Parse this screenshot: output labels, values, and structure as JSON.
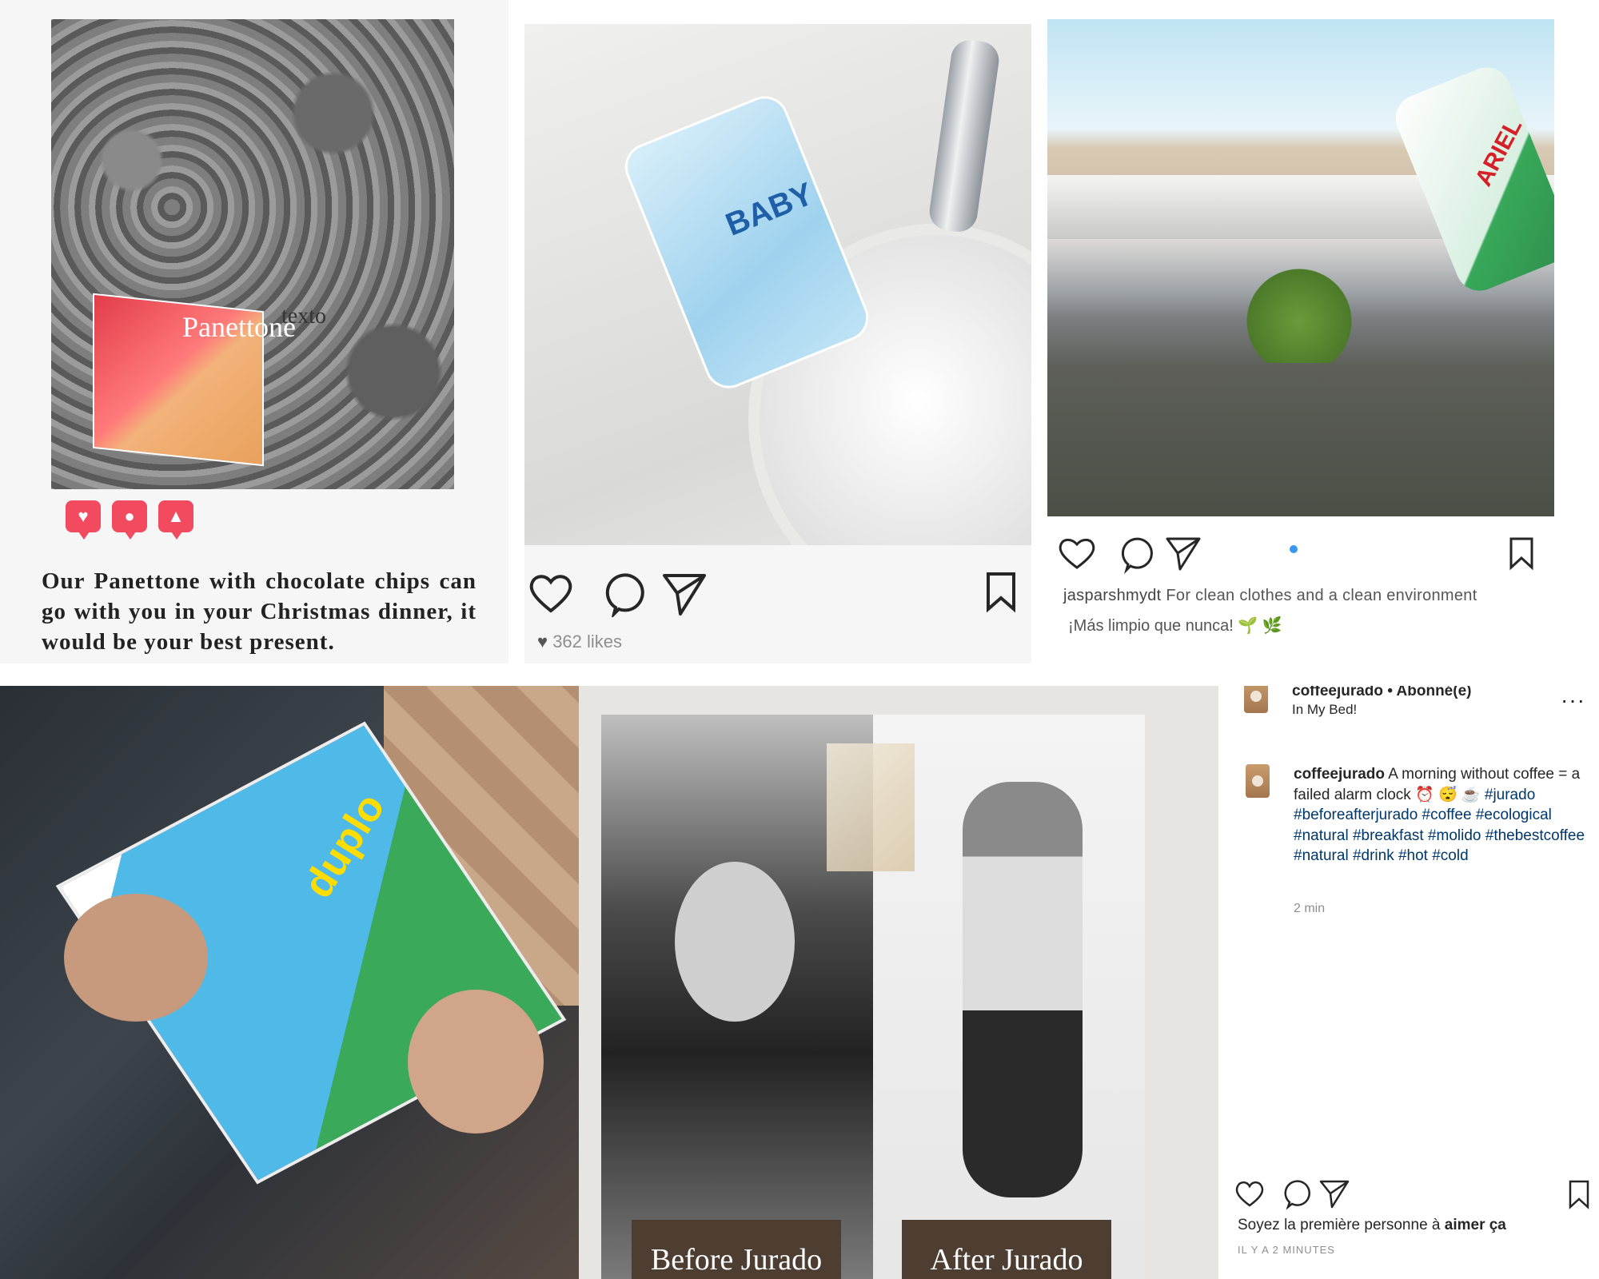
{
  "panel_1": {
    "product_label": "Panettone",
    "overlay_text": "texto",
    "notification_icons": [
      "heart",
      "comment",
      "user"
    ],
    "caption": "Our Panettone with chocolate chips can go with you in your Christmas dinner, it would be your best present."
  },
  "panel_2": {
    "product_label": "BABY",
    "likes": "362 likes"
  },
  "panel_3": {
    "product_label": "ARIEL",
    "username": "jasparshmydt",
    "caption": "For clean clothes and a clean environment",
    "caption_line2": "¡Más limpio que nunca! 🌱 🌿"
  },
  "panel_4": {
    "product_label": "duplo"
  },
  "panel_5": {
    "before_label": "Before Jurado",
    "after_label": "After Jurado"
  },
  "panel_6": {
    "header_username": "coffeejurado",
    "header_status": "• Abonné(e)",
    "header_location": "In My Bed!",
    "more_label": "···",
    "comment_username": "coffeejurado",
    "comment_text": "A morning without coffee = a failed alarm clock ⏰ 😴 ☕",
    "hashtags": "#jurado #beforeafterjurado #coffee #ecological #natural #breakfast #molido #thebestcoffee #natural #drink #hot #cold",
    "comment_time": "2 min",
    "first_like_prefix": "Soyez la première personne à ",
    "first_like_bold": "aimer ça",
    "posted_ago": "IL Y A 2 MINUTES"
  }
}
